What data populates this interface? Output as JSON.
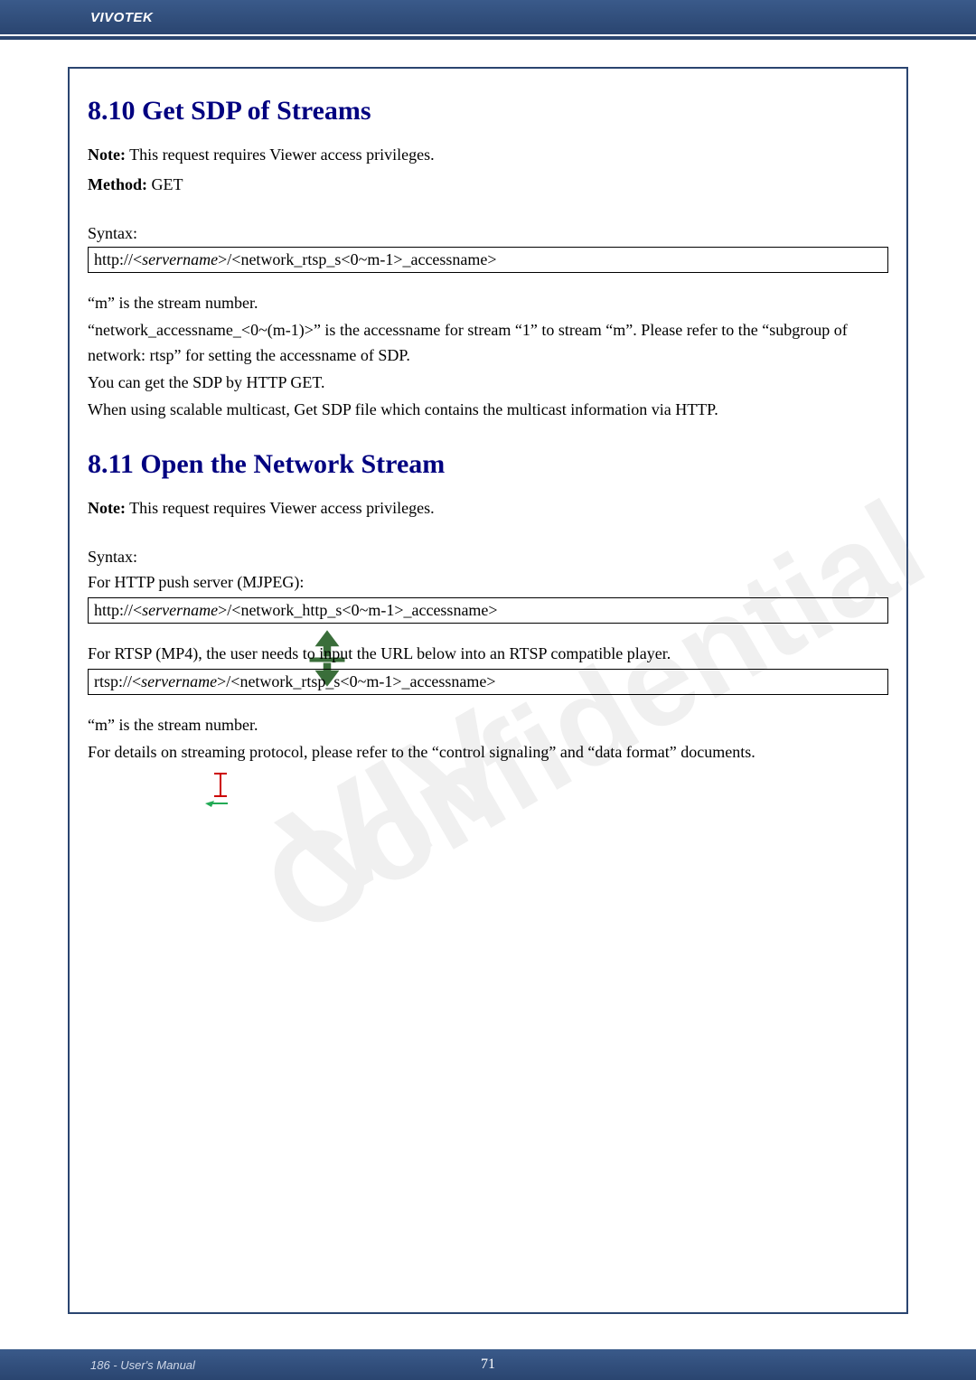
{
  "header": {
    "brand": "VIVOTEK"
  },
  "section1": {
    "title": "8.10 Get SDP of Streams",
    "note_label": "Note:",
    "note_text": " This request requires Viewer access privileges.",
    "method_label": "Method:",
    "method_value": " GET",
    "syntax_label": "Syntax:",
    "code_prefix": "http://<",
    "code_italic": "servername",
    "code_suffix": ">/<network_rtsp_s<0~m-1>_accessname>",
    "para1": "“m” is the stream number.",
    "para2": "“network_accessname_<0~(m-1)>” is the accessname for stream “1” to stream “m”. Please refer to the “subgroup of network: rtsp” for setting the accessname of SDP.",
    "para3": "You can get the SDP by HTTP GET.",
    "para4": "When using scalable multicast, Get SDP file which contains the multicast information via HTTP."
  },
  "section2": {
    "title": "8.11 Open the Network Stream",
    "note_label": "Note:",
    "note_text": " This request requires Viewer access privileges.",
    "syntax_label": "Syntax:",
    "mjpeg_label": "For HTTP push server (MJPEG):",
    "code1_prefix": "http://<",
    "code1_italic": "servername",
    "code1_suffix": ">/<network_http_s<0~m-1>_accessname>",
    "rtsp_label": "For RTSP (MP4), the user needs to input the URL below into an RTSP compatible player.",
    "code2_prefix": "rtsp://<",
    "code2_italic": "servername",
    "code2_suffix": ">/<network_rtsp_s<0~m-1>_accessname>",
    "para1": "“m” is the stream number.",
    "para2": "For details on streaming protocol, please refer to the “control signaling” and “data format” documents."
  },
  "footer": {
    "left": "186 - User's Manual",
    "center": "71"
  }
}
